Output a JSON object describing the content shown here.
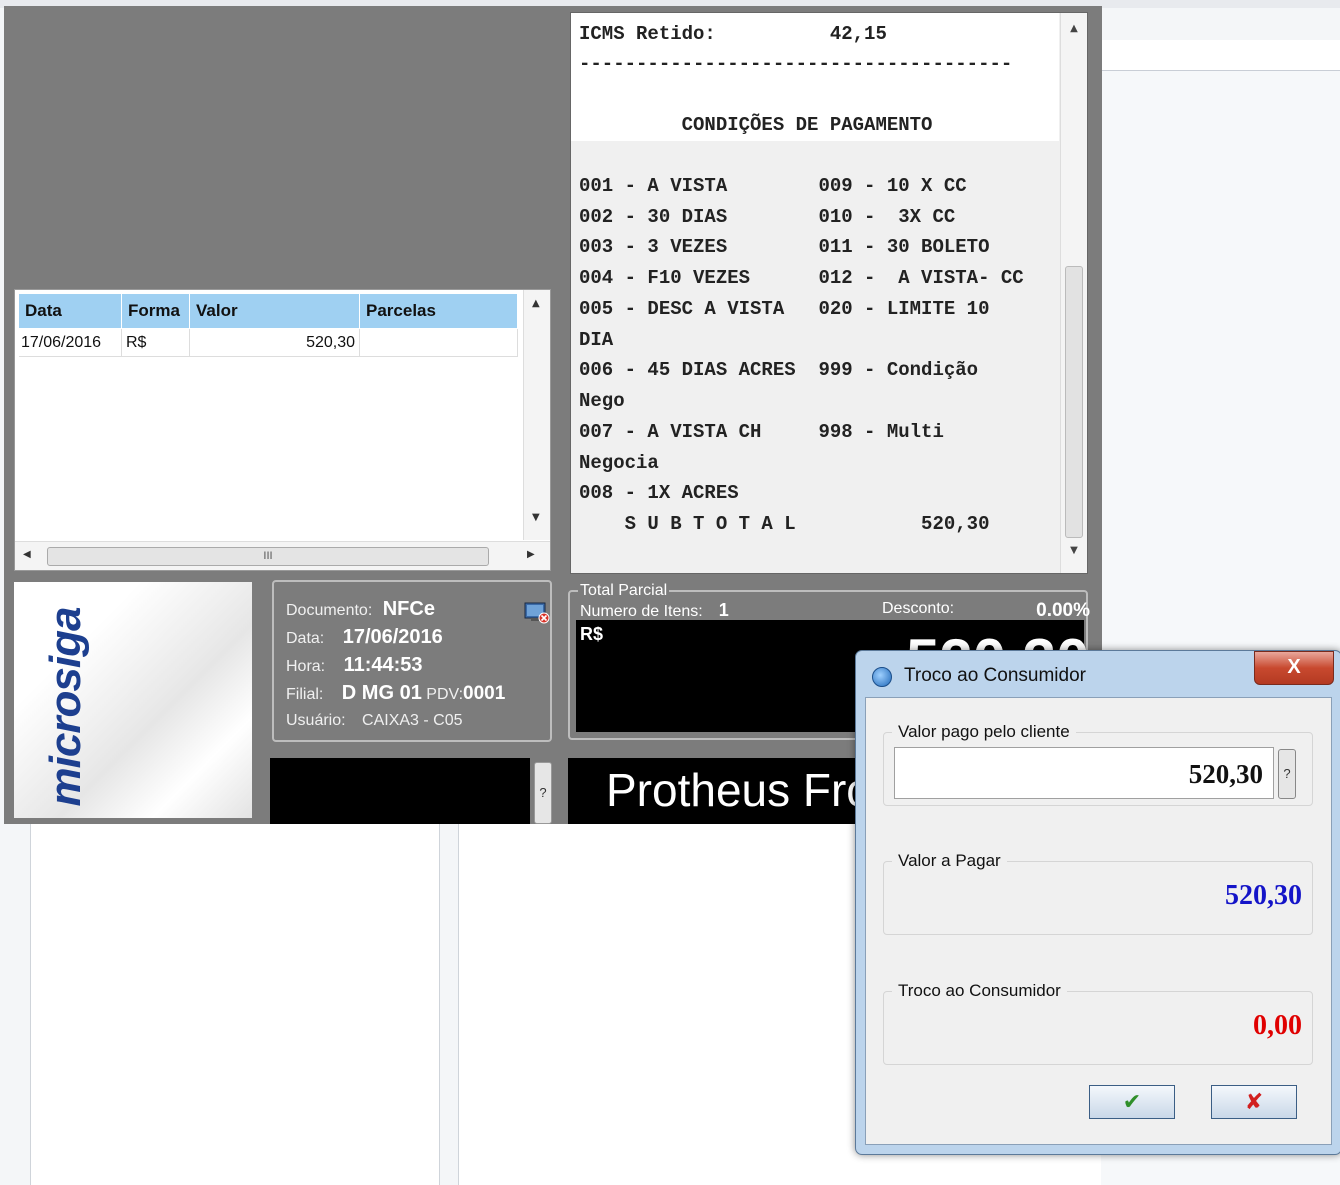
{
  "receipt": {
    "lines": [
      "ICMS Retido:          42,15",
      "--------------------------------------",
      "",
      "         CONDIÇÕES DE PAGAMENTO",
      "",
      "001 - A VISTA        009 - 10 X CC",
      "002 - 30 DIAS        010 -  3X CC",
      "003 - 3 VEZES        011 - 30 BOLETO",
      "004 - F10 VEZES      012 -  A VISTA- CC",
      "005 - DESC A VISTA   020 - LIMITE 10",
      "DIA",
      "006 - 45 DIAS ACRES  999 - Condição",
      "Nego",
      "007 - A VISTA CH     998 - Multi",
      "Negocia",
      "008 - 1X ACRES",
      "    S U B T O T A L           520,30"
    ]
  },
  "payments": {
    "headers": [
      "Data",
      "Forma",
      "Valor",
      "Parcelas"
    ],
    "rows": [
      {
        "data": "17/06/2016",
        "forma": "R$",
        "valor": "520,30",
        "parcelas": ""
      }
    ],
    "hscroll_grip": "III"
  },
  "logo": {
    "text": "microsiga"
  },
  "document": {
    "doc_label": "Documento:",
    "doc_value": "NFCe",
    "date_label": "Data:",
    "date_value": "17/06/2016",
    "time_label": "Hora:",
    "time_value": "11:44:53",
    "branch_label": "Filial:",
    "branch_value": "D MG 01",
    "pdv_label": "PDV:",
    "pdv_value": "0001",
    "user_label": "Usuário:",
    "user_value": "CAIXA3 - C05"
  },
  "help_button": "?",
  "total": {
    "legend": "Total Parcial",
    "items_label": "Numero de Itens:",
    "items_value": "1",
    "discount_label": "Desconto:",
    "discount_value": "0.00%",
    "currency": "R$",
    "big_total": "520,30"
  },
  "banner": {
    "text": "Protheus Fro"
  },
  "dialog": {
    "title": "Troco ao Consumidor",
    "close_label": "X",
    "paid_label": "Valor pago pelo cliente",
    "paid_value": "520,30",
    "help_label": "?",
    "topay_label": "Valor a Pagar",
    "topay_value": "520,30",
    "change_label": "Troco ao Consumidor",
    "change_value": "0,00",
    "ok_icon": "✔",
    "cancel_icon": "✘",
    "colors": {
      "topay": "#1414c8",
      "change": "#e00000"
    }
  }
}
